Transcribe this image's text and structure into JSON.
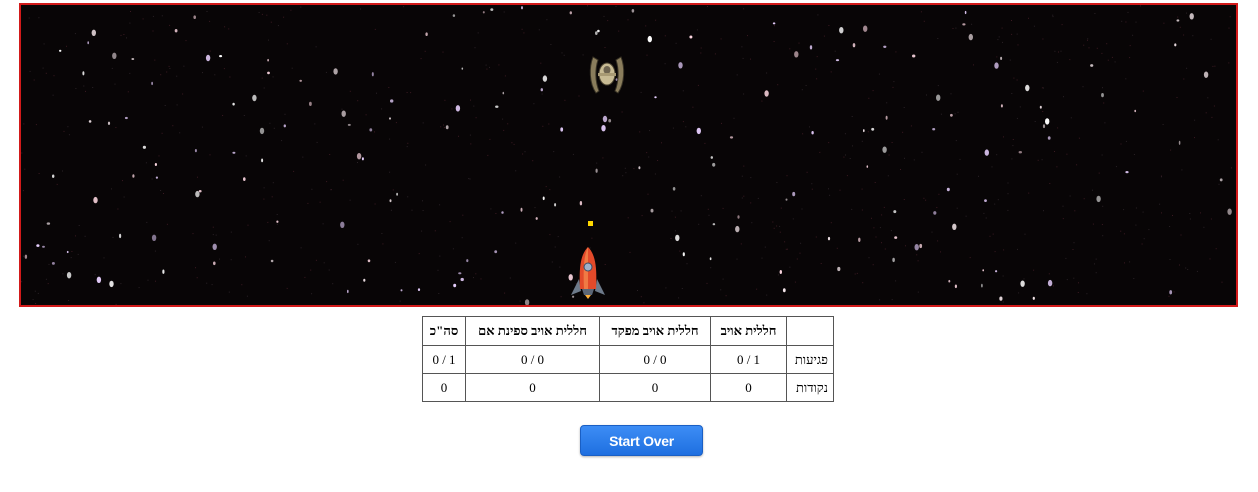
{
  "scoreboard": {
    "headers": [
      "",
      "חללית אויב",
      "חללית אויב מפקד",
      "חללית אויב ספינת אם",
      "סה\"כ"
    ],
    "rows": [
      {
        "label": "פגיעות",
        "cells": [
          "0 / 1",
          "0 / 0",
          "0 / 0",
          "0 / 1"
        ]
      },
      {
        "label": "נקודות",
        "cells": [
          "0",
          "0",
          "0",
          "0"
        ]
      }
    ]
  },
  "controls": {
    "start_over_label": "Start Over"
  },
  "colors": {
    "game_border": "#d21a1a",
    "space_background": "#080506",
    "bullet": "#ffd800",
    "button": "#2a7de9"
  },
  "sprites": {
    "enemy": "enemy-fighter-ship-icon",
    "player": "rocket-icon",
    "bullet": "bullet"
  }
}
